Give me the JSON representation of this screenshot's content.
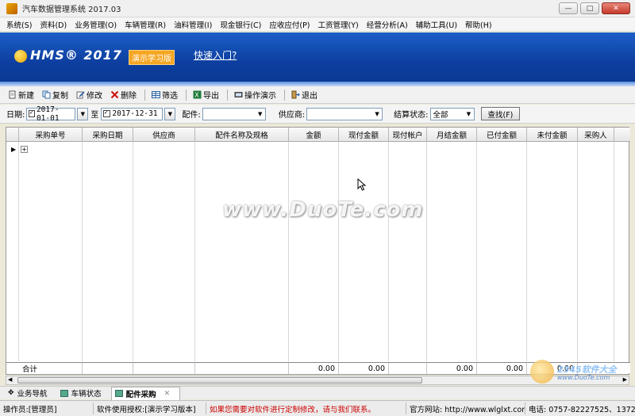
{
  "window": {
    "title": "汽车数据管理系统 2017.03",
    "controls": [
      "—",
      "□",
      "✕"
    ]
  },
  "menu": [
    "系统(S)",
    "资料(D)",
    "业务管理(O)",
    "车辆管理(R)",
    "油料管理(I)",
    "现金银行(C)",
    "应收应付(P)",
    "工资管理(Y)",
    "经营分析(A)",
    "辅助工具(U)",
    "帮助(H)"
  ],
  "banner": {
    "logo": "HMS® 2017",
    "badge": "演示学习版",
    "quick_link": "快速入门?"
  },
  "toolbar": {
    "new": "新建",
    "copy": "复制",
    "edit": "修改",
    "delete": "删除",
    "filter": "筛选",
    "export": "导出",
    "demo": "操作演示",
    "exit": "退出"
  },
  "filters": {
    "date_label": "日期:",
    "date_from": "2017-01-01",
    "to_label": "至",
    "date_to": "2017-12-31",
    "part_label": "配件:",
    "part_value": "",
    "supplier_label": "供应商:",
    "supplier_value": "",
    "settle_label": "结算状态:",
    "settle_value": "全部",
    "search_button": "查找(F)"
  },
  "grid": {
    "columns": [
      "采购单号",
      "采购日期",
      "供应商",
      "配件名称及规格",
      "金额",
      "现付金额",
      "现付帐户",
      "月结金额",
      "已付金额",
      "未付金额",
      "采购人"
    ],
    "row_marker": "▶",
    "expander": "+",
    "footer": {
      "label": "合计",
      "amount": "0.00",
      "cash_paid": "0.00",
      "monthly": "0.00",
      "paid": "0.00",
      "unpaid": "0.00"
    }
  },
  "tabs": [
    {
      "label": "业务导航",
      "active": false
    },
    {
      "label": "车辆状态",
      "active": false
    },
    {
      "label": "配件采购",
      "active": true
    }
  ],
  "status": {
    "operator": "操作员:[管理员]",
    "license": "软件使用授权:[演示学习版本]",
    "notice": "如果您需要对软件进行定制修改，请与我们联系。",
    "website": "官方网站: http://www.wlglxt.com",
    "phone": "电话: 0757-82227525、13725"
  },
  "watermark": {
    "main": "www.DuoTe.com",
    "corner_big": "2345软件大全",
    "corner_small": "www.DuoTe.com"
  },
  "colors": {
    "banner": "#0d3fa0",
    "badge": "#f5a623",
    "notice": "#cc0000"
  }
}
